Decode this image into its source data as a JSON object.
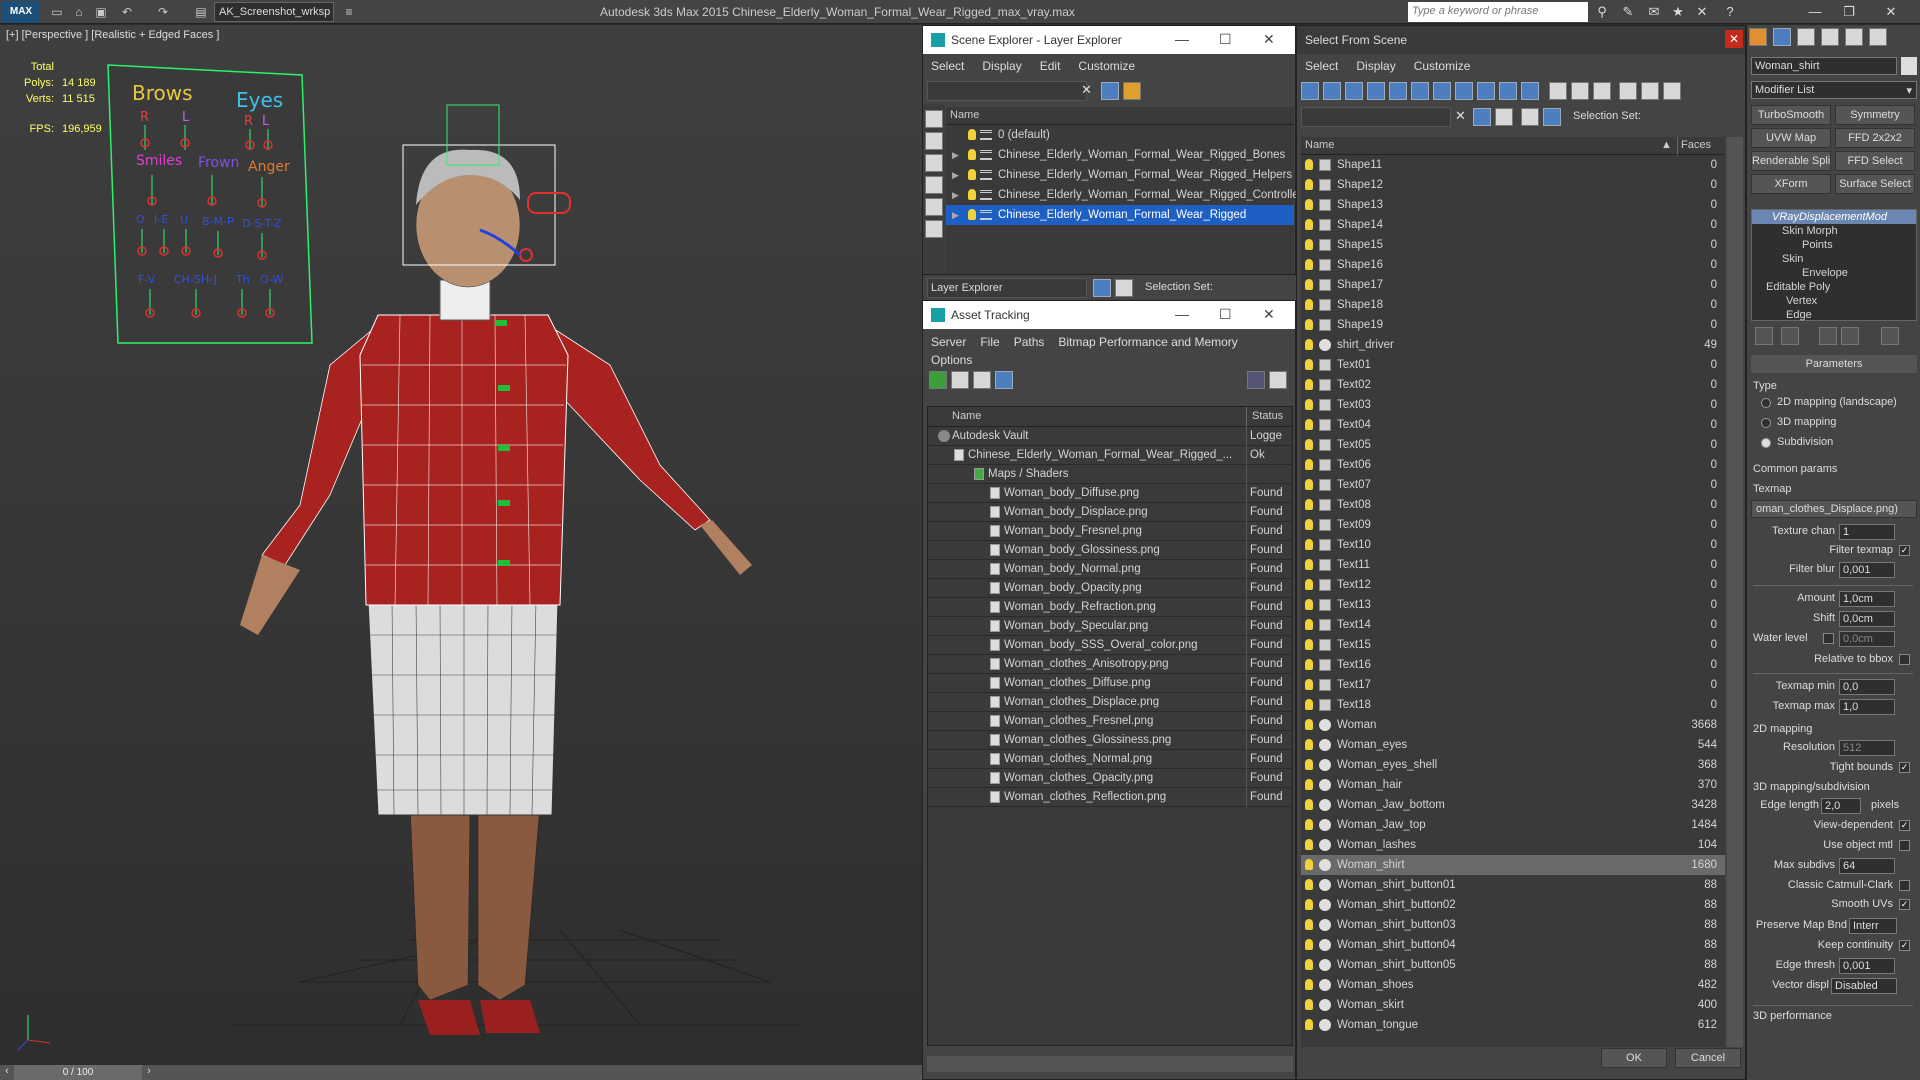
{
  "app": {
    "title": "Autodesk 3ds Max  2015     Chinese_Elderly_Woman_Formal_Wear_Rigged_max_vray.max",
    "workspace": "AK_Screenshot_wrksp",
    "search_placeholder": "Type a keyword or phrase",
    "logo": "MAX"
  },
  "viewport": {
    "label": "[+] [Perspective ] [Realistic + Edged Faces ]",
    "total_label": "Total",
    "polys_label": "Polys:",
    "polys": "14 189",
    "verts_label": "Verts:",
    "verts": "11 515",
    "fps_label": "FPS:",
    "fps": "196,959",
    "face_labels": {
      "brows": "Brows",
      "eyes": "Eyes",
      "r1": "R",
      "l1": "L",
      "r2": "R",
      "l2": "L",
      "smiles": "Smiles",
      "frown": "Frown",
      "anger": "Anger",
      "o": "O",
      "ie": "I-E",
      "u": "U",
      "bmp": "B-M-P",
      "dstz": "D-S-T-Z",
      "fv": "F-V",
      "chshj": "CH-SH-J",
      "th": "Th",
      "ow": "O-W"
    },
    "frame": "0 / 100"
  },
  "scene_explorer": {
    "title": "Scene Explorer - Layer Explorer",
    "menu": [
      "Select",
      "Display",
      "Edit",
      "Customize"
    ],
    "column": "Name",
    "layers": [
      "0 (default)",
      "Chinese_Elderly_Woman_Formal_Wear_Rigged_Bones",
      "Chinese_Elderly_Woman_Formal_Wear_Rigged_Helpers",
      "Chinese_Elderly_Woman_Formal_Wear_Rigged_Controllers",
      "Chinese_Elderly_Woman_Formal_Wear_Rigged"
    ],
    "footer_drop": "Layer Explorer",
    "selection_set": "Selection Set:"
  },
  "asset_tracking": {
    "title": "Asset Tracking",
    "menu": [
      "Server",
      "File",
      "Paths",
      "Bitmap Performance and Memory",
      "Options"
    ],
    "col_name": "Name",
    "col_status": "Status",
    "rows": [
      {
        "name": "Autodesk Vault",
        "status": "Logge"
      },
      {
        "name": "Chinese_Elderly_Woman_Formal_Wear_Rigged_...",
        "status": "Ok"
      },
      {
        "name": "Maps / Shaders",
        "status": ""
      },
      {
        "name": "Woman_body_Diffuse.png",
        "status": "Found"
      },
      {
        "name": "Woman_body_Displace.png",
        "status": "Found"
      },
      {
        "name": "Woman_body_Fresnel.png",
        "status": "Found"
      },
      {
        "name": "Woman_body_Glossiness.png",
        "status": "Found"
      },
      {
        "name": "Woman_body_Normal.png",
        "status": "Found"
      },
      {
        "name": "Woman_body_Opacity.png",
        "status": "Found"
      },
      {
        "name": "Woman_body_Refraction.png",
        "status": "Found"
      },
      {
        "name": "Woman_body_Specular.png",
        "status": "Found"
      },
      {
        "name": "Woman_body_SSS_Overal_color.png",
        "status": "Found"
      },
      {
        "name": "Woman_clothes_Anisotropy.png",
        "status": "Found"
      },
      {
        "name": "Woman_clothes_Diffuse.png",
        "status": "Found"
      },
      {
        "name": "Woman_clothes_Displace.png",
        "status": "Found"
      },
      {
        "name": "Woman_clothes_Fresnel.png",
        "status": "Found"
      },
      {
        "name": "Woman_clothes_Glossiness.png",
        "status": "Found"
      },
      {
        "name": "Woman_clothes_Normal.png",
        "status": "Found"
      },
      {
        "name": "Woman_clothes_Opacity.png",
        "status": "Found"
      },
      {
        "name": "Woman_clothes_Reflection.png",
        "status": "Found"
      }
    ]
  },
  "select_from_scene": {
    "title": "Select From Scene",
    "menu": [
      "Select",
      "Display",
      "Customize"
    ],
    "selection_set": "Selection Set:",
    "col_name": "Name",
    "col_faces": "Faces",
    "rows": [
      {
        "n": "Shape11",
        "f": "0",
        "t": "shape"
      },
      {
        "n": "Shape12",
        "f": "0",
        "t": "shape"
      },
      {
        "n": "Shape13",
        "f": "0",
        "t": "shape"
      },
      {
        "n": "Shape14",
        "f": "0",
        "t": "shape"
      },
      {
        "n": "Shape15",
        "f": "0",
        "t": "shape"
      },
      {
        "n": "Shape16",
        "f": "0",
        "t": "shape"
      },
      {
        "n": "Shape17",
        "f": "0",
        "t": "shape"
      },
      {
        "n": "Shape18",
        "f": "0",
        "t": "shape"
      },
      {
        "n": "Shape19",
        "f": "0",
        "t": "shape"
      },
      {
        "n": "shirt_driver",
        "f": "49",
        "t": "geo"
      },
      {
        "n": "Text01",
        "f": "0",
        "t": "shape"
      },
      {
        "n": "Text02",
        "f": "0",
        "t": "shape"
      },
      {
        "n": "Text03",
        "f": "0",
        "t": "shape"
      },
      {
        "n": "Text04",
        "f": "0",
        "t": "shape"
      },
      {
        "n": "Text05",
        "f": "0",
        "t": "shape"
      },
      {
        "n": "Text06",
        "f": "0",
        "t": "shape"
      },
      {
        "n": "Text07",
        "f": "0",
        "t": "shape"
      },
      {
        "n": "Text08",
        "f": "0",
        "t": "shape"
      },
      {
        "n": "Text09",
        "f": "0",
        "t": "shape"
      },
      {
        "n": "Text10",
        "f": "0",
        "t": "shape"
      },
      {
        "n": "Text11",
        "f": "0",
        "t": "shape"
      },
      {
        "n": "Text12",
        "f": "0",
        "t": "shape"
      },
      {
        "n": "Text13",
        "f": "0",
        "t": "shape"
      },
      {
        "n": "Text14",
        "f": "0",
        "t": "shape"
      },
      {
        "n": "Text15",
        "f": "0",
        "t": "shape"
      },
      {
        "n": "Text16",
        "f": "0",
        "t": "shape"
      },
      {
        "n": "Text17",
        "f": "0",
        "t": "shape"
      },
      {
        "n": "Text18",
        "f": "0",
        "t": "shape"
      },
      {
        "n": "Woman",
        "f": "3668",
        "t": "geo"
      },
      {
        "n": "Woman_eyes",
        "f": "544",
        "t": "geo"
      },
      {
        "n": "Woman_eyes_shell",
        "f": "368",
        "t": "geo"
      },
      {
        "n": "Woman_hair",
        "f": "370",
        "t": "geo"
      },
      {
        "n": "Woman_Jaw_bottom",
        "f": "3428",
        "t": "geo"
      },
      {
        "n": "Woman_Jaw_top",
        "f": "1484",
        "t": "geo"
      },
      {
        "n": "Woman_lashes",
        "f": "104",
        "t": "geo"
      },
      {
        "n": "Woman_shirt",
        "f": "1680",
        "t": "geo"
      },
      {
        "n": "Woman_shirt_button01",
        "f": "88",
        "t": "geo"
      },
      {
        "n": "Woman_shirt_button02",
        "f": "88",
        "t": "geo"
      },
      {
        "n": "Woman_shirt_button03",
        "f": "88",
        "t": "geo"
      },
      {
        "n": "Woman_shirt_button04",
        "f": "88",
        "t": "geo"
      },
      {
        "n": "Woman_shirt_button05",
        "f": "88",
        "t": "geo"
      },
      {
        "n": "Woman_shoes",
        "f": "482",
        "t": "geo"
      },
      {
        "n": "Woman_skirt",
        "f": "400",
        "t": "geo"
      },
      {
        "n": "Woman_tongue",
        "f": "612",
        "t": "geo"
      }
    ],
    "ok": "OK",
    "cancel": "Cancel"
  },
  "command_panel": {
    "object_name": "Woman_shirt",
    "modifier_list": "Modifier List",
    "buttons": [
      "TurboSmooth",
      "Symmetry",
      "UVW Map",
      "FFD 2x2x2",
      "Renderable Spline",
      "FFD Select",
      "XForm",
      "Surface Select"
    ],
    "stack": [
      "VRayDisplacementMod",
      "Skin Morph",
      "Points",
      "Skin",
      "Envelope",
      "Editable Poly",
      "Vertex",
      "Edge"
    ],
    "parameters": "Parameters",
    "type": "Type",
    "type_2d": "2D mapping (landscape)",
    "type_3d": "3D mapping",
    "type_sub": "Subdivision",
    "common": "Common params",
    "texmap": "Texmap",
    "texmap_val": "oman_clothes_Displace.png)",
    "tex_chan": "Texture chan",
    "tex_chan_val": "1",
    "filter_texmap": "Filter texmap",
    "filter_blur": "Filter blur",
    "filter_blur_val": "0,001",
    "amount": "Amount",
    "amount_val": "1,0cm",
    "shift": "Shift",
    "shift_val": "0,0cm",
    "water": "Water level",
    "water_val": "0,0cm",
    "rel_bbox": "Relative to bbox",
    "tmin": "Texmap min",
    "tmin_val": "0,0",
    "tmax": "Texmap max",
    "tmax_val": "1,0",
    "map2d": "2D mapping",
    "resolution": "Resolution",
    "resolution_val": "512",
    "tight": "Tight bounds",
    "map3d": "3D mapping/subdivision",
    "edge_len": "Edge length",
    "edge_len_val": "2,0",
    "pixels": "pixels",
    "view_dep": "View-dependent",
    "use_obj": "Use object mtl",
    "max_subdivs": "Max subdivs",
    "max_subdivs_val": "64",
    "classic": "Classic Catmull-Clark",
    "smooth_uv": "Smooth UVs",
    "preserve": "Preserve Map Bnd",
    "preserve_val": "Interr",
    "keep": "Keep continuity",
    "edge_thresh": "Edge thresh",
    "edge_thresh_val": "0,001",
    "vector": "Vector displ",
    "vector_val": "Disabled",
    "perf": "3D performance"
  }
}
